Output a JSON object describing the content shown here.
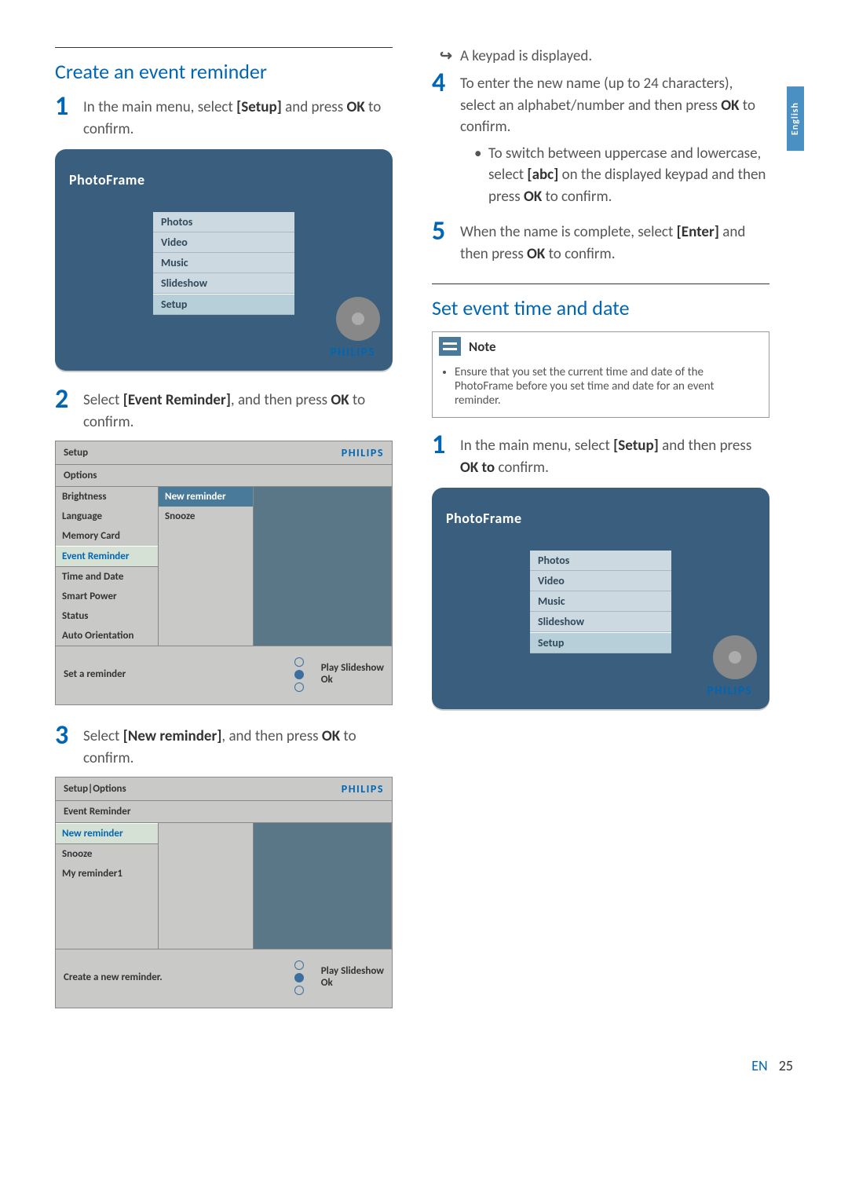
{
  "language_tab": "English",
  "left": {
    "heading": "Create an event reminder",
    "step1_num": "1",
    "step1": "In the main menu, select [Setup] and press OK to confirm.",
    "device": {
      "title": "PhotoFrame",
      "menu": [
        "Photos",
        "Video",
        "Music",
        "Slideshow",
        "Setup"
      ],
      "brand": "PHILIPS"
    },
    "step2_num": "2",
    "step2": "Select [Event Reminder], and then press OK to confirm.",
    "panel1": {
      "title": "Setup",
      "brand": "PHILIPS",
      "subtitle": "Options",
      "colA": [
        "Brightness",
        "Language",
        "Memory Card",
        "Event Reminder",
        "Time and Date",
        "Smart Power",
        "Status",
        "Auto Orientation"
      ],
      "colA_sel_index": 3,
      "colB": [
        "New reminder",
        "Snooze"
      ],
      "footer_left": "Set a reminder",
      "footer_r1": "Play Slideshow",
      "footer_r2": "Ok"
    },
    "step3_num": "3",
    "step3": "Select [New reminder], and then press OK to confirm.",
    "panel2": {
      "title": "Setup|Options",
      "brand": "PHILIPS",
      "subtitle": "Event Reminder",
      "colA": [
        "New reminder",
        "Snooze",
        "My reminder1"
      ],
      "colA_sel_index": 0,
      "footer_left": "Create  a new reminder.",
      "footer_r1": "Play Slideshow",
      "footer_r2": "Ok"
    }
  },
  "right": {
    "result": "A keypad is displayed.",
    "step4_num": "4",
    "step4_a": "To enter the new name (up to 24 characters), select an alphabet/number and then press OK to confirm.",
    "step4_b": "To switch between uppercase and lowercase, select [abc] on the displayed keypad and then press OK to confirm.",
    "step5_num": "5",
    "step5": "When the name is complete, select [Enter] and then press OK to confirm.",
    "heading2": "Set event time and date",
    "note_label": "Note",
    "note_text": "Ensure that you set the current time and date of the PhotoFrame before you set time and date for an event reminder.",
    "step1b_num": "1",
    "step1b": "In the main menu, select [Setup] and then press OK to confirm.",
    "device": {
      "title": "PhotoFrame",
      "menu": [
        "Photos",
        "Video",
        "Music",
        "Slideshow",
        "Setup"
      ],
      "brand": "PHILIPS"
    }
  },
  "footer": {
    "lang": "EN",
    "page": "25"
  }
}
